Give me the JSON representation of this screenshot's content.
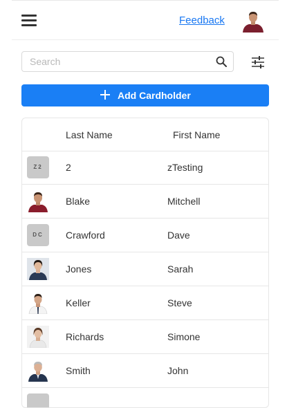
{
  "header": {
    "feedback_label": "Feedback"
  },
  "search": {
    "placeholder": "Search",
    "value": ""
  },
  "toolbar": {
    "add_label": "Add Cardholder"
  },
  "table": {
    "columns": [
      "Last Name",
      "First Name"
    ],
    "rows": [
      {
        "initials": "Z2",
        "last": "2",
        "first": "zTesting"
      },
      {
        "initials": "",
        "last": "Blake",
        "first": "Mitchell"
      },
      {
        "initials": "DC",
        "last": "Crawford",
        "first": "Dave"
      },
      {
        "initials": "",
        "last": "Jones",
        "first": "Sarah"
      },
      {
        "initials": "",
        "last": "Keller",
        "first": "Steve"
      },
      {
        "initials": "",
        "last": "Richards",
        "first": "Simone"
      },
      {
        "initials": "",
        "last": "Smith",
        "first": "John"
      }
    ]
  },
  "colors": {
    "accent": "#1a7ff5",
    "link": "#1877f2",
    "initials_bg": "#c9c9c9"
  }
}
